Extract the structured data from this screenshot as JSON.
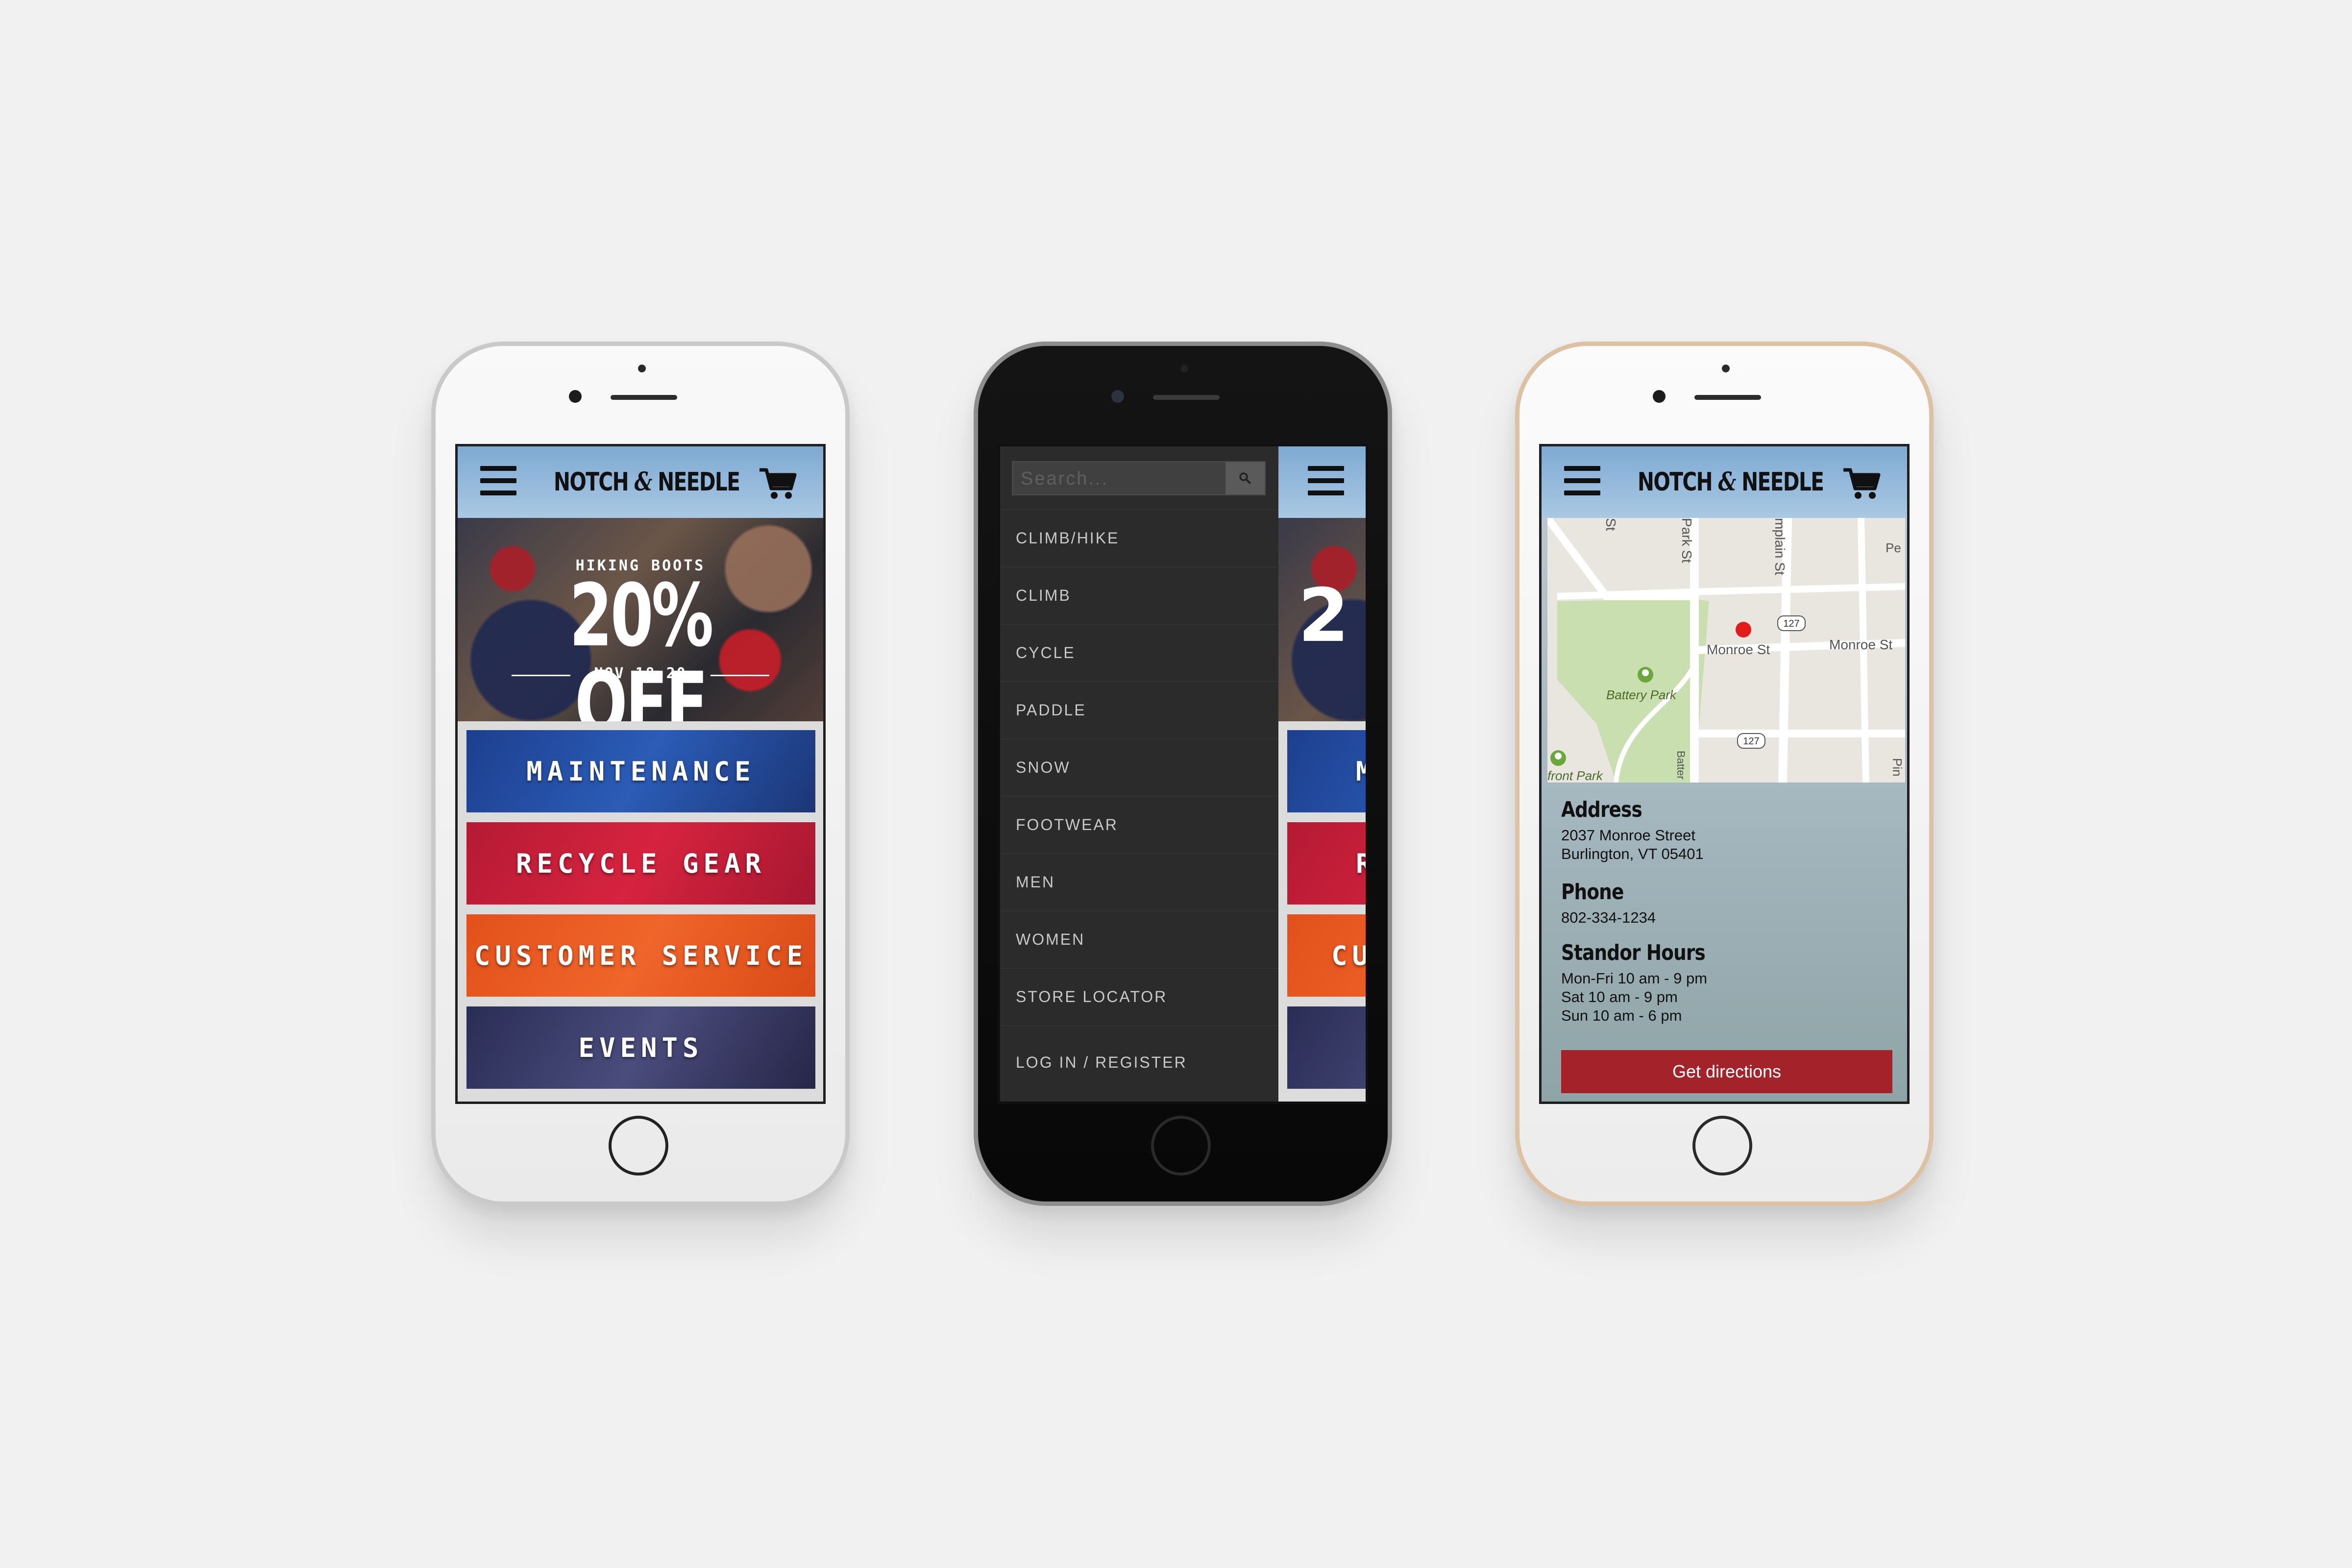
{
  "brand": {
    "logo_left": "NOTCH",
    "logo_amp": "&",
    "logo_right": "NEEDLE"
  },
  "promo": {
    "subtitle": "HIKING BOOTS",
    "headline": "20% OFF",
    "dates": "NOV 18-20"
  },
  "categories": [
    "MAINTENANCE",
    "RECYCLE GEAR",
    "CUSTOMER SERVICE",
    "EVENTS"
  ],
  "peek_categories": [
    "M",
    "R",
    "CU",
    ""
  ],
  "peek_headline": "2",
  "drawer": {
    "search_placeholder": "Search...",
    "items": [
      "CLIMB/HIKE",
      "CLIMB",
      "CYCLE",
      "PADDLE",
      "SNOW",
      "FOOTWEAR",
      "MEN",
      "WOMEN",
      "STORE LOCATOR",
      "LOG IN / REGISTER"
    ]
  },
  "map": {
    "labels": {
      "park_st": "Park St",
      "champlain_st": "mplain St",
      "monroe_st_a": "Monroe St",
      "monroe_st_b": "Monroe St",
      "battery_park": "Battery Park",
      "front_park": "front Park",
      "route_1": "127",
      "route_2": "127",
      "st_edge": "St",
      "pe_edge": "Pe",
      "pin_edge": "Pin",
      "battery_edge": "Batter"
    }
  },
  "store": {
    "address_heading": "Address",
    "address_line1": "2037 Monroe Street",
    "address_line2": "Burlington, VT 05401",
    "phone_heading": "Phone",
    "phone": "802-334-1234",
    "hours_heading": "Standor Hours",
    "hours": [
      "Mon-Fri 10 am - 9 pm",
      "Sat 10 am - 9 pm",
      "Sun 10 am - 6 pm"
    ],
    "directions_button": "Get directions"
  },
  "colors": {
    "header_blue": "#8fb5da",
    "directions_red": "#a4232a",
    "drawer_bg": "#2b2b2b",
    "map_pin": "#e31b1b"
  },
  "icons": [
    "hamburger-icon",
    "cart-icon",
    "search-icon",
    "map-pin-icon",
    "tree-icon"
  ]
}
